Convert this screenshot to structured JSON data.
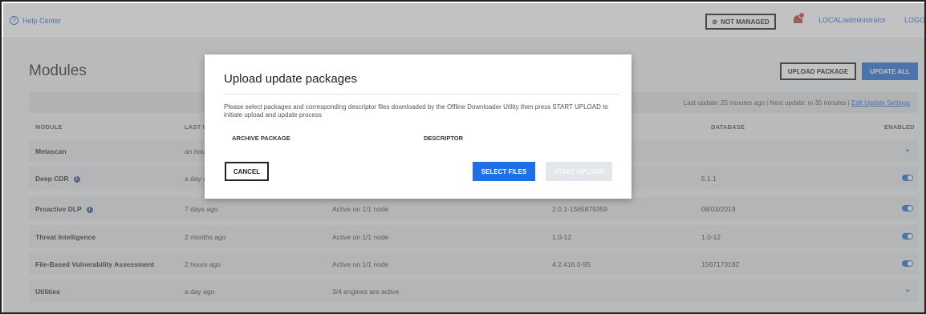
{
  "header": {
    "help_label": "Help Center",
    "not_managed_label": "NOT MANAGED",
    "user_label": "LOCAL/administrator",
    "logout_label": "LOGOU"
  },
  "page": {
    "title": "Modules",
    "upload_package_label": "UPLOAD PACKAGE",
    "update_all_label": "UPDATE ALL",
    "update_info": "Last update: 25 minutes ago | Next update: in 35 minutes |",
    "edit_settings_link": "Edit Update Settings"
  },
  "table": {
    "columns": {
      "module": "MODULE",
      "last_update": "LAST U",
      "database": "DATABASE",
      "enabled": "ENABLED"
    },
    "rows": [
      {
        "name": "Metascan",
        "last": "an hou",
        "status": "",
        "version": "",
        "database": "",
        "info": false,
        "control": "chevron"
      },
      {
        "name": "Deep CDR",
        "last": "a day a",
        "status": "",
        "version": "",
        "database": "5.1.1",
        "info": true,
        "control": "toggle"
      },
      {
        "name": "Proactive DLP",
        "last": "7 days ago",
        "status": "Active on 1/1 node",
        "version": "2.0.1-1565879359",
        "database": "08/03/2019",
        "info": true,
        "control": "toggle"
      },
      {
        "name": "Threat Intelligence",
        "last": "2 months ago",
        "status": "Active on 1/1 node",
        "version": "1.0-12",
        "database": "1.0-12",
        "info": false,
        "control": "toggle"
      },
      {
        "name": "File-Based Vulnerability Assessment",
        "last": "2 hours ago",
        "status": "Active on 1/1 node",
        "version": "4.2.416.0-95",
        "database": "1567173182",
        "info": false,
        "control": "toggle"
      },
      {
        "name": "Utilities",
        "last": "a day ago",
        "status": "3/4 engines are active",
        "version": "",
        "database": "",
        "info": false,
        "control": "chevron"
      }
    ]
  },
  "dialog": {
    "title": "Upload update packages",
    "description": "Please select packages and corresponding descriptor files downloaded by the Offline Downloader Utility then press START UPLOAD to initiate upload and update process",
    "archive_label": "ARCHIVE PACKAGE",
    "descriptor_label": "DESCRIPTOR",
    "cancel_label": "CANCEL",
    "select_label": "SELECT FILES",
    "start_label": "START UPLOAD"
  },
  "colors": {
    "accent": "#2b6fd6",
    "primary_button": "#1f70e8"
  }
}
